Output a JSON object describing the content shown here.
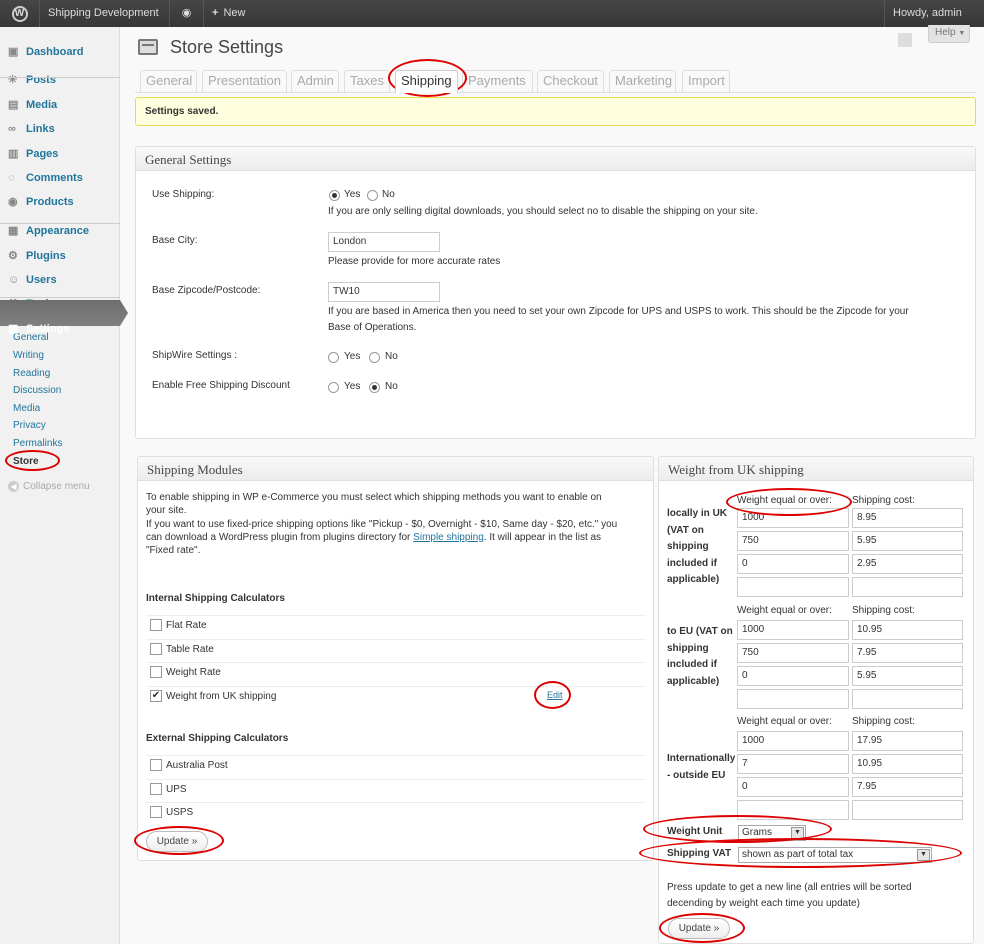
{
  "adminbar": {
    "site": "Shipping Development",
    "new_label": "New",
    "howdy": "Howdy, admin"
  },
  "sidebar": {
    "items": [
      {
        "label": "Dashboard",
        "icon": "dashboard-icon"
      },
      {
        "label": "Posts",
        "icon": "pin-icon"
      },
      {
        "label": "Media",
        "icon": "media-icon"
      },
      {
        "label": "Links",
        "icon": "link-icon"
      },
      {
        "label": "Pages",
        "icon": "page-icon"
      },
      {
        "label": "Comments",
        "icon": "comment-icon"
      },
      {
        "label": "Products",
        "icon": "products-icon"
      },
      {
        "label": "Appearance",
        "icon": "appearance-icon"
      },
      {
        "label": "Plugins",
        "icon": "plugin-icon"
      },
      {
        "label": "Users",
        "icon": "users-icon"
      },
      {
        "label": "Tools",
        "icon": "tools-icon"
      },
      {
        "label": "Settings",
        "icon": "settings-icon"
      }
    ],
    "subitems": [
      "General",
      "Writing",
      "Reading",
      "Discussion",
      "Media",
      "Privacy",
      "Permalinks",
      "Store"
    ],
    "collapse": "Collapse menu"
  },
  "page": {
    "title": "Store Settings",
    "help": "Help"
  },
  "tabs": [
    "General",
    "Presentation",
    "Admin",
    "Taxes",
    "Shipping",
    "Payments",
    "Checkout",
    "Marketing",
    "Import"
  ],
  "notice": "Settings saved.",
  "general": {
    "title": "General Settings",
    "use_shipping": {
      "label": "Use Shipping:",
      "yes": "Yes",
      "no": "No",
      "help": "If you are only selling digital downloads, you should select no to disable the shipping on your site."
    },
    "base_city": {
      "label": "Base City:",
      "value": "London",
      "help": "Please provide for more accurate rates"
    },
    "base_zip": {
      "label": "Base Zipcode/Postcode:",
      "value": "TW10",
      "help1": "If you are based in America then you need to set your own Zipcode for UPS and USPS to work. This should be the Zipcode for your",
      "help2": "Base of Operations."
    },
    "shipwire": {
      "label": "ShipWire Settings :",
      "yes": "Yes",
      "no": "No"
    },
    "free_ship": {
      "label": "Enable Free Shipping Discount",
      "yes": "Yes",
      "no": "No"
    }
  },
  "modules": {
    "title": "Shipping Modules",
    "intro1": "To enable shipping in WP e-Commerce you must select which shipping methods you want to enable on",
    "intro2": "your site.",
    "intro3": "If you want to use fixed-price shipping options like \"Pickup - $0, Overnight - $10, Same day - $20, etc.\" you",
    "intro4a": "can download a WordPress plugin from plugins directory for ",
    "intro4link": "Simple shipping",
    "intro4b": ". It will appear in the list as",
    "intro5": "\"Fixed rate\".",
    "internal_title": "Internal Shipping Calculators",
    "internal": [
      {
        "label": "Flat Rate",
        "checked": false
      },
      {
        "label": "Table Rate",
        "checked": false
      },
      {
        "label": "Weight Rate",
        "checked": false
      },
      {
        "label": "Weight from UK shipping",
        "checked": true
      }
    ],
    "edit": "Edit",
    "external_title": "External Shipping Calculators",
    "external": [
      {
        "label": "Australia Post",
        "checked": false
      },
      {
        "label": "UPS",
        "checked": false
      },
      {
        "label": "USPS",
        "checked": false
      }
    ],
    "update": "Update »"
  },
  "weight": {
    "title": "Weight from UK shipping",
    "col_weight": "Weight equal or over:",
    "col_cost": "Shipping cost:",
    "zones": [
      {
        "label": [
          "locally in UK",
          "(VAT on",
          "shipping",
          "included if",
          "applicable)"
        ],
        "rows": [
          [
            "1000",
            "8.95"
          ],
          [
            "750",
            "5.95"
          ],
          [
            "0",
            "2.95"
          ],
          [
            "",
            ""
          ]
        ]
      },
      {
        "label": [
          "to EU (VAT on",
          "shipping",
          "included if",
          "applicable)"
        ],
        "rows": [
          [
            "1000",
            "10.95"
          ],
          [
            "750",
            "7.95"
          ],
          [
            "0",
            "5.95"
          ],
          [
            "",
            ""
          ]
        ]
      },
      {
        "label": [
          "Internationally",
          "- outside EU"
        ],
        "rows": [
          [
            "1000",
            "17.95"
          ],
          [
            "7",
            "10.95"
          ],
          [
            "0",
            "7.95"
          ],
          [
            "",
            ""
          ]
        ]
      }
    ],
    "unit_label": "Weight Unit",
    "unit_value": "Grams",
    "vat_label": "Shipping VAT",
    "vat_value": "shown as part of total tax",
    "note1": "Press update to get a new line (all entries will be sorted",
    "note2": "decending by weight each time you update)",
    "update": "Update »"
  }
}
